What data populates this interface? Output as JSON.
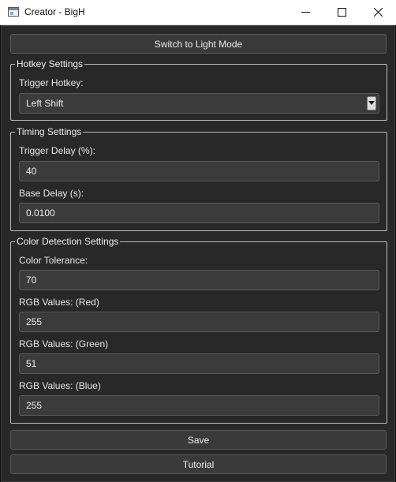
{
  "window": {
    "title": "Creator - BigH"
  },
  "theme_button": {
    "label": "Switch to Light Mode"
  },
  "hotkey_settings": {
    "title": "Hotkey Settings",
    "trigger_hotkey_label": "Trigger Hotkey:",
    "trigger_hotkey_value": "Left Shift"
  },
  "timing_settings": {
    "title": "Timing Settings",
    "trigger_delay_label": "Trigger Delay (%):",
    "trigger_delay_value": "40",
    "base_delay_label": "Base Delay (s):",
    "base_delay_value": "0.0100"
  },
  "color_settings": {
    "title": "Color Detection Settings",
    "tolerance_label": "Color Tolerance:",
    "tolerance_value": "70",
    "red_label": "RGB Values: (Red)",
    "red_value": "255",
    "green_label": "RGB Values: (Green)",
    "green_value": "51",
    "blue_label": "RGB Values: (Blue)",
    "blue_value": "255"
  },
  "actions": {
    "save_label": "Save",
    "tutorial_label": "Tutorial"
  },
  "icons": {
    "app": "window-app-icon",
    "minimize": "minimize-icon",
    "maximize": "maximize-icon",
    "close": "close-icon",
    "dropdown": "chevron-down-icon"
  },
  "colors": {
    "background": "#282828",
    "field": "#3b3b3b",
    "text": "#e6e6e6",
    "titlebar": "#ffffff"
  }
}
